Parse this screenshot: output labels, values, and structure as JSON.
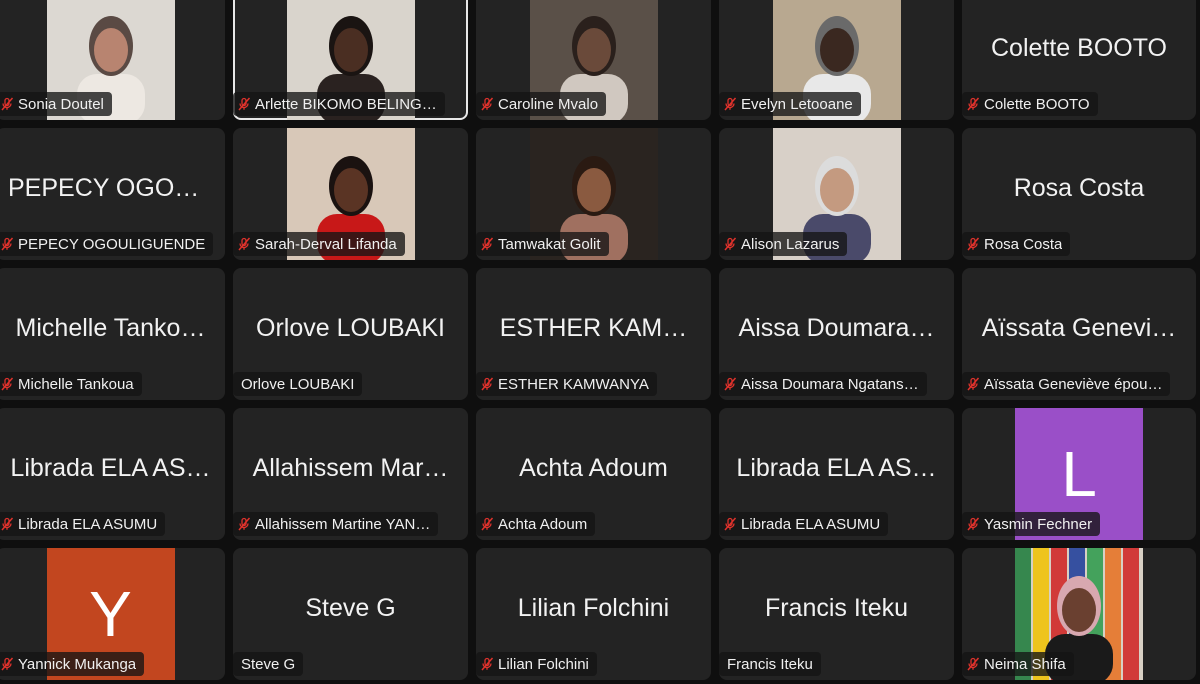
{
  "participants": [
    {
      "display": "",
      "label": "Sonia Doutel",
      "muted": true,
      "video": true,
      "bg": "#dcd8d2",
      "skin": "#b88470",
      "hair": "#5a4a44",
      "shirt": "#ede8e2"
    },
    {
      "display": "",
      "label": "Arlette BIKOMO BELING…",
      "muted": true,
      "video": true,
      "active": true,
      "bg": "#d9d4cc",
      "skin": "#4a2e22",
      "hair": "#1a1412",
      "shirt": "#2a2220"
    },
    {
      "display": "",
      "label": "Caroline Mvalo",
      "muted": true,
      "video": true,
      "bg": "#5a5048",
      "skin": "#6a4a3a",
      "hair": "#2a201c",
      "shirt": "#d0c8c0"
    },
    {
      "display": "",
      "label": "Evelyn Letooane",
      "muted": true,
      "video": true,
      "bg": "#b8a890",
      "skin": "#3a2820",
      "hair": "#6a6a6a",
      "shirt": "#e8e8e8"
    },
    {
      "display": "Colette BOOTO",
      "label": "Colette BOOTO",
      "muted": true,
      "video": false
    },
    {
      "display": "PEPECY OGOU…",
      "label": "PEPECY OGOULIGUENDE",
      "muted": true,
      "video": false
    },
    {
      "display": "",
      "label": "Sarah-Derval Lifanda",
      "muted": true,
      "video": true,
      "bg": "#d8c8b8",
      "skin": "#5a3424",
      "hair": "#1a1210",
      "shirt": "#c81818"
    },
    {
      "display": "",
      "label": "Tamwakat Golit",
      "muted": true,
      "video": true,
      "bg": "#2a2420",
      "skin": "#8a5a40",
      "hair": "#2a1a12",
      "shirt": "#a07060"
    },
    {
      "display": "",
      "label": "Alison Lazarus",
      "muted": true,
      "video": true,
      "bg": "#d8d0c8",
      "skin": "#c49a80",
      "hair": "#dcdcdc",
      "shirt": "#4a4a6a"
    },
    {
      "display": "Rosa Costa",
      "label": "Rosa Costa",
      "muted": true,
      "video": false
    },
    {
      "display": "Michelle Tanko…",
      "label": "Michelle Tankoua",
      "muted": true,
      "video": false
    },
    {
      "display": "Orlove LOUBAKI",
      "label": "Orlove LOUBAKI",
      "muted": false,
      "video": false
    },
    {
      "display": "ESTHER KAM…",
      "label": "ESTHER KAMWANYA",
      "muted": true,
      "video": false
    },
    {
      "display": "Aissa Doumara…",
      "label": "Aissa Doumara Ngatans…",
      "muted": true,
      "video": false
    },
    {
      "display": "Aïssata Genevi…",
      "label": "Aïssata Geneviève épou…",
      "muted": true,
      "video": false
    },
    {
      "display": "Librada ELA AS…",
      "label": "Librada ELA ASUMU",
      "muted": true,
      "video": false
    },
    {
      "display": "Allahissem Mar…",
      "label": "Allahissem Martine YAN…",
      "muted": true,
      "video": false
    },
    {
      "display": "Achta Adoum",
      "label": "Achta Adoum",
      "muted": true,
      "video": false
    },
    {
      "display": "Librada ELA AS…",
      "label": "Librada ELA ASUMU",
      "muted": true,
      "video": false
    },
    {
      "display": "",
      "label": "Yasmin Fechner",
      "muted": true,
      "video": false,
      "avatar": "L",
      "avatar_color": "#9a4fc8"
    },
    {
      "display": "",
      "label": "Yannick Mukanga",
      "muted": true,
      "video": false,
      "avatar": "Y",
      "avatar_color": "#c2461f"
    },
    {
      "display": "Steve G",
      "label": "Steve G",
      "muted": false,
      "video": false
    },
    {
      "display": "Lilian Folchini",
      "label": "Lilian Folchini",
      "muted": true,
      "video": false
    },
    {
      "display": "Francis Iteku",
      "label": "Francis Iteku",
      "muted": false,
      "video": false
    },
    {
      "display": "",
      "label": "Neima Shifa",
      "muted": true,
      "video": true,
      "flags": true,
      "bg": "#d8d0c4",
      "skin": "#6a4030",
      "hair": "#d8a8b0",
      "shirt": "#1a1a1a"
    }
  ],
  "colors": {
    "background": "#0f0f0f",
    "tile": "#232323",
    "muted_icon": "#e0322c",
    "text": "#f0f0f0"
  }
}
